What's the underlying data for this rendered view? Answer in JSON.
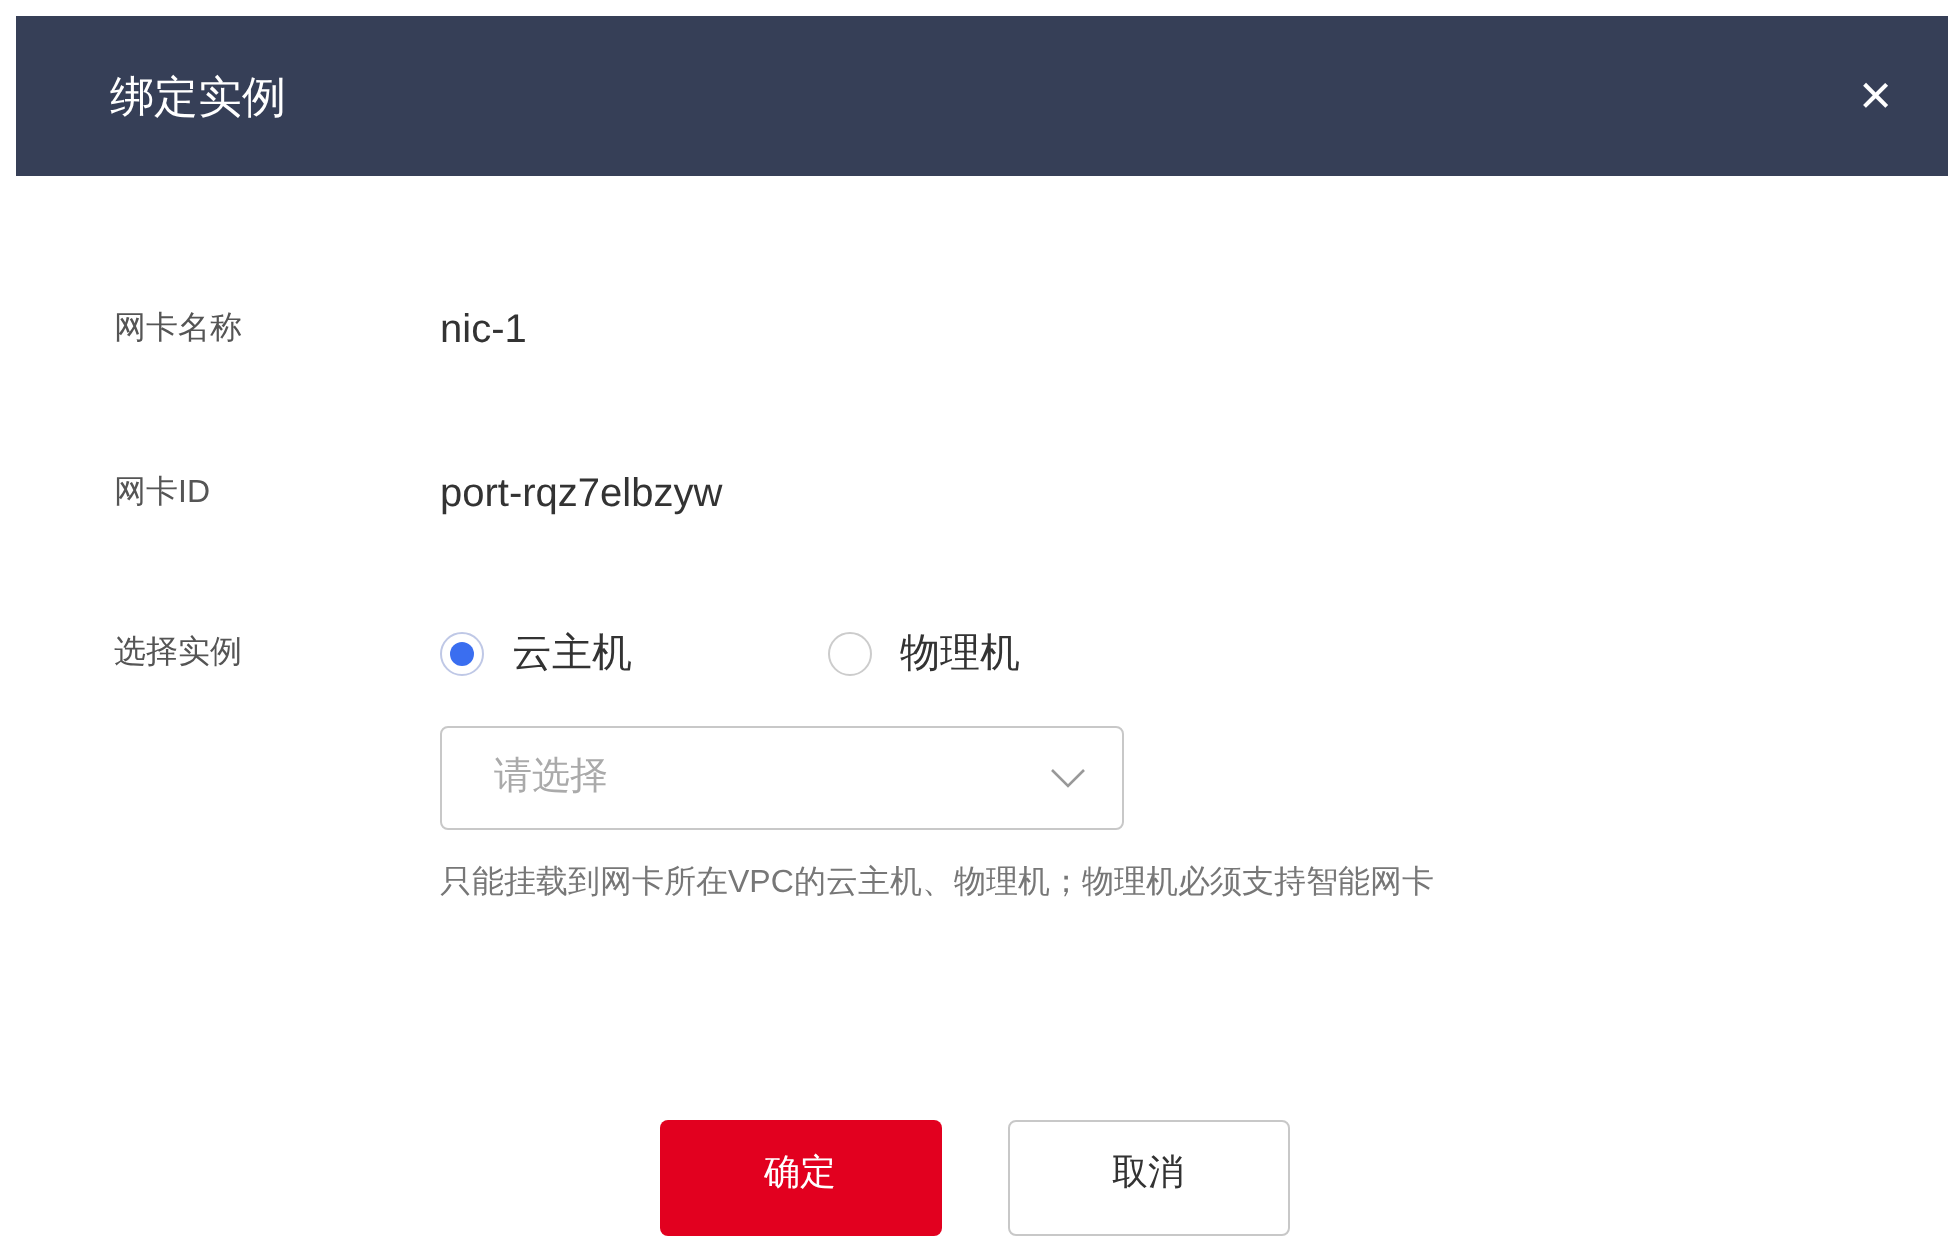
{
  "dialog": {
    "title": "绑定实例",
    "close": "×"
  },
  "fields": [
    {
      "label": "网卡名称",
      "value": "nic-1"
    },
    {
      "label": "网卡ID",
      "value": "port-rqz7elbzyw"
    }
  ],
  "instance": {
    "label": "选择实例",
    "options": [
      {
        "label": "云主机",
        "selected": true
      },
      {
        "label": "物理机",
        "selected": false
      }
    ],
    "select": {
      "placeholder": "请选择"
    },
    "hint": "只能挂载到网卡所在VPC的云主机、物理机；物理机必须支持智能网卡"
  },
  "buttons": [
    {
      "label": "确定",
      "kind": "primary"
    },
    {
      "label": "取消",
      "kind": "secondary"
    }
  ]
}
